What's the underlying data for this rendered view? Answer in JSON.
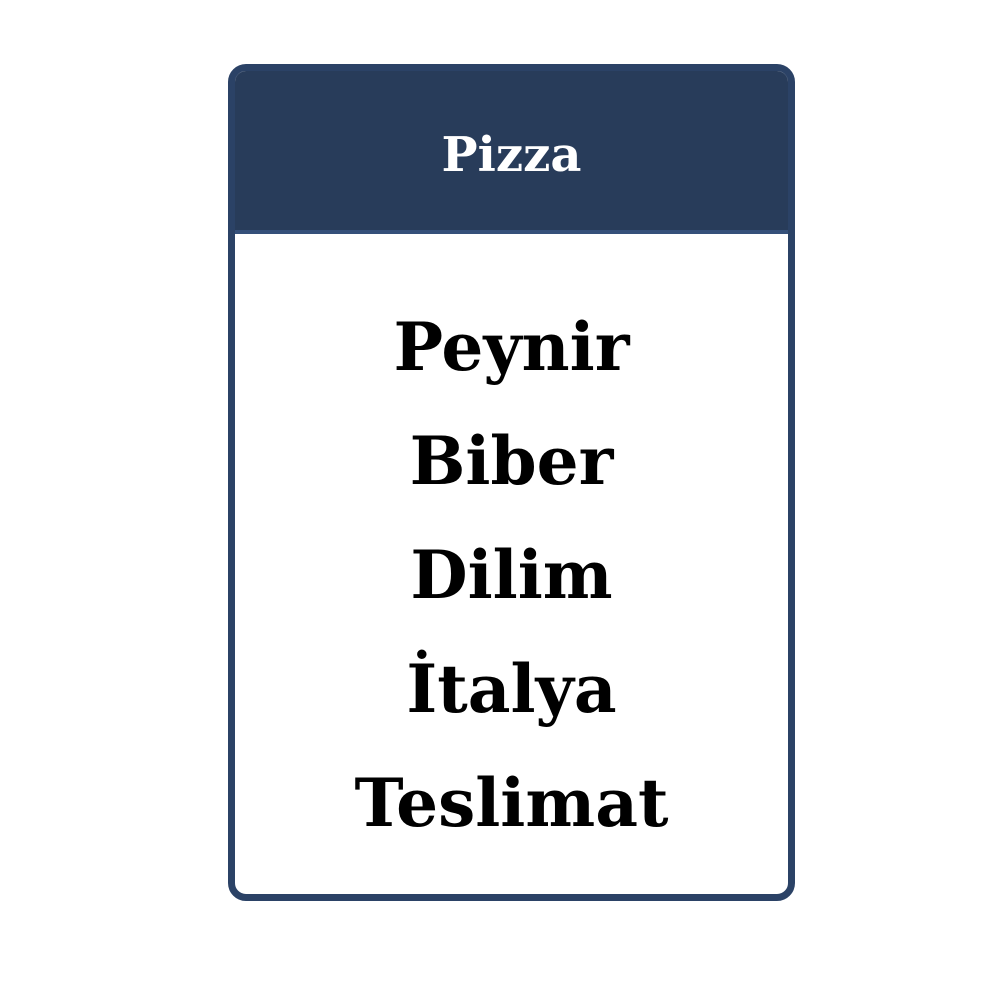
{
  "card": {
    "title": "Pizza",
    "words": [
      "Peynir",
      "Biber",
      "Dilim",
      "İtalya",
      "Teslimat"
    ]
  },
  "colors": {
    "header_background": "#283c5a",
    "border": "#2b4266",
    "title_text": "#ffffff",
    "word_text": "#000000",
    "card_background": "#ffffff"
  }
}
